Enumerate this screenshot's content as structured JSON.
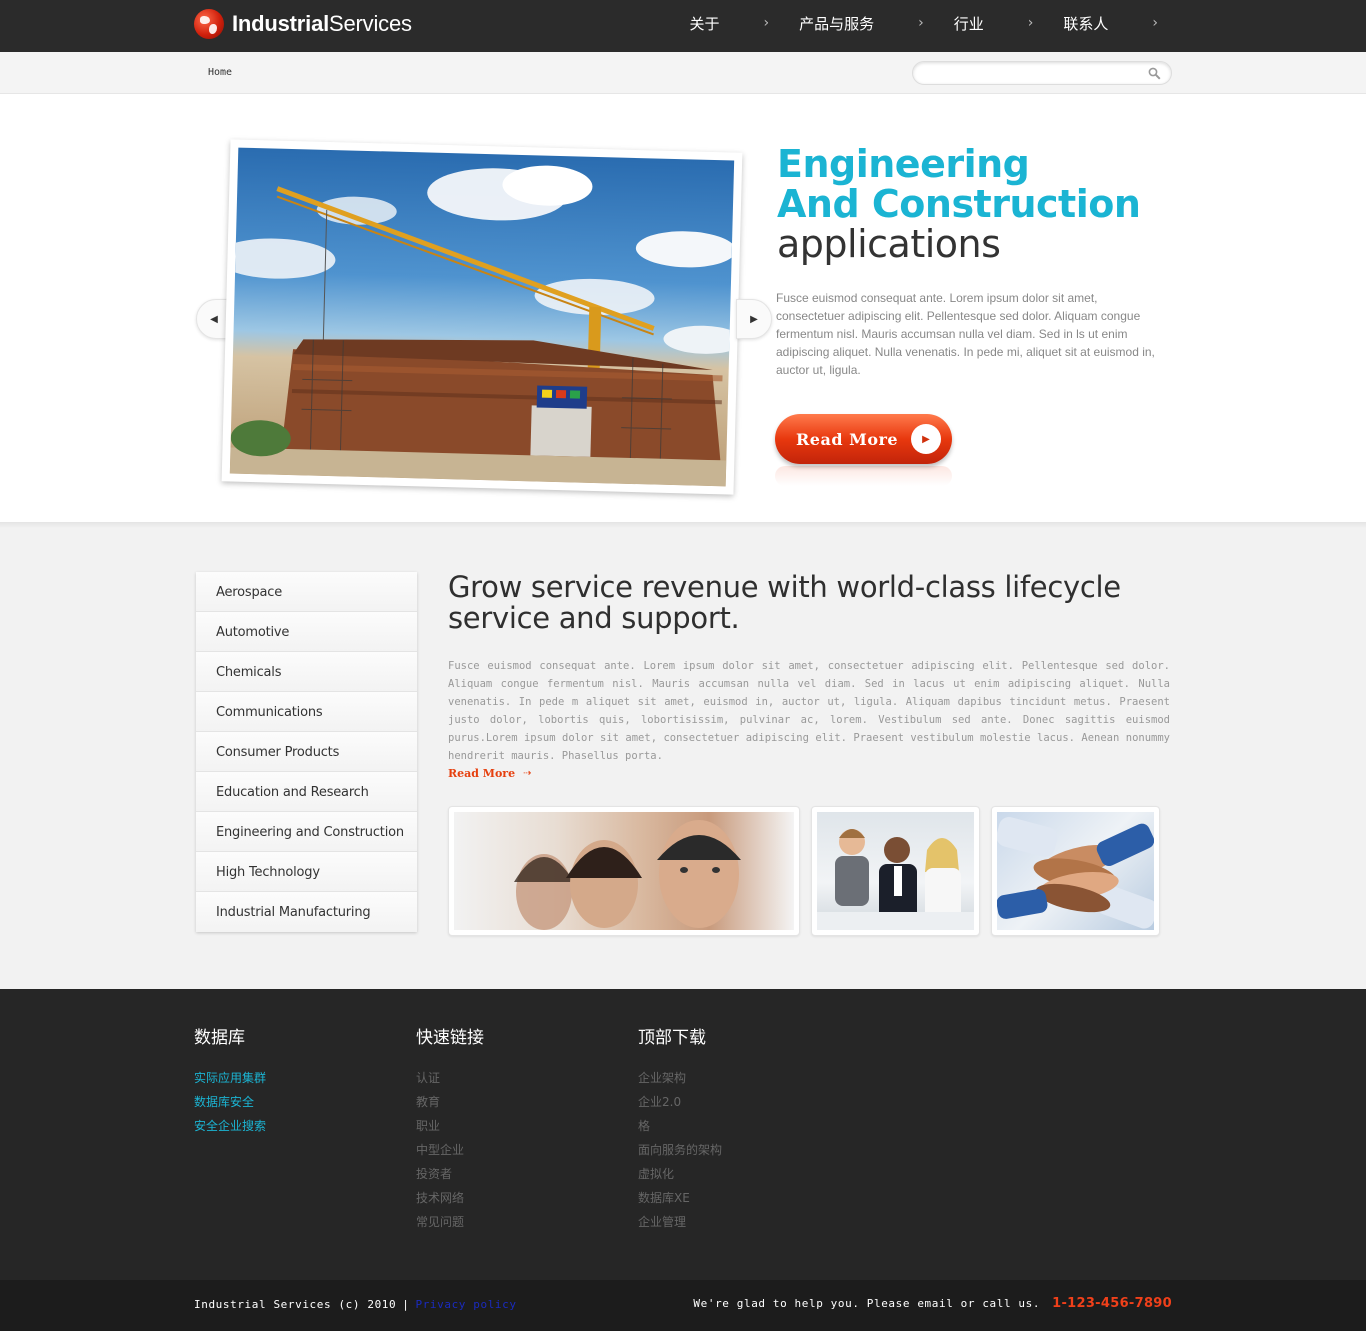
{
  "header": {
    "logo_bold": "Industrial",
    "logo_regular": "Services",
    "nav": [
      {
        "label": "关于",
        "icon": "chevron-right-icon"
      },
      {
        "label": "产品与服务",
        "icon": "chevron-right-icon"
      },
      {
        "label": "行业",
        "icon": "chevron-right-icon"
      },
      {
        "label": "联系人",
        "icon": "chevron-right-icon"
      }
    ]
  },
  "breadcrumb": {
    "home": "Home"
  },
  "search": {
    "value": "",
    "placeholder": "",
    "icon": "search-icon"
  },
  "hero": {
    "title_line1": "Engineering",
    "title_line2": "And Construction",
    "title_line3": "applications",
    "text": "Fusce euismod consequat ante. Lorem ipsum dolor sit amet, consectetuer adipiscing elit. Pellentesque sed dolor. Aliquam congue fermentum nisl. Mauris accumsan nulla vel diam. Sed in ls ut enim adipiscing aliquet. Nulla venenatis. In pede mi, aliquet sit at euismod in, auctor ut, ligula.",
    "read_more_label": "Read More",
    "accent_color": "#1bb4d3",
    "button_color": "#e8380e"
  },
  "sidebar": {
    "items": [
      {
        "label": "Aerospace"
      },
      {
        "label": "Automotive"
      },
      {
        "label": "Chemicals"
      },
      {
        "label": "Communications"
      },
      {
        "label": "Consumer Products"
      },
      {
        "label": "Education and Research"
      },
      {
        "label": "Engineering and Construction"
      },
      {
        "label": "High Technology"
      },
      {
        "label": "Industrial Manufacturing"
      }
    ]
  },
  "main": {
    "title": "Grow service revenue with world-class lifecycle service and support.",
    "text": "Fusce euismod consequat ante. Lorem ipsum dolor sit amet, consectetuer adipiscing elit. Pellentesque sed dolor. Aliquam congue fermentum nisl. Mauris accumsan nulla vel diam. Sed in lacus ut enim adipiscing aliquet. Nulla venenatis. In pede m aliquet sit amet, euismod in, auctor ut, ligula. Aliquam dapibus tincidunt metus. Praesent justo dolor, lobortis quis, lobortisissim, pulvinar ac, lorem. Vestibulum sed ante. Donec sagittis euismod purus.Lorem ipsum dolor sit amet, consectetuer adipiscing elit. Praesent vestibulum molestie lacus. Aenean nonummy hendrerit mauris. Phasellus porta.",
    "read_more_label": "Read More"
  },
  "footer": {
    "col1": {
      "title": "数据库",
      "links": [
        "实际应用集群",
        "数据库安全",
        "安全企业搜索"
      ]
    },
    "col2": {
      "title": "快速链接",
      "links": [
        "认证",
        "教育",
        "职业",
        "中型企业",
        "投资者",
        "技术网络",
        "常见问题"
      ]
    },
    "col3": {
      "title": "顶部下载",
      "links": [
        "企业架构",
        "企业2.0",
        "格",
        "面向服务的架构",
        "虚拟化",
        "数据库XE",
        "企业管理"
      ]
    },
    "copyright": "Industrial Services (c) 2010",
    "separator": "|",
    "privacy_label": "Privacy policy",
    "help_text": "We're glad to help you. Please email or call us.",
    "phone": "1-123-456-7890",
    "link_color": "#1bb4d3",
    "phone_color": "#f0401a"
  }
}
